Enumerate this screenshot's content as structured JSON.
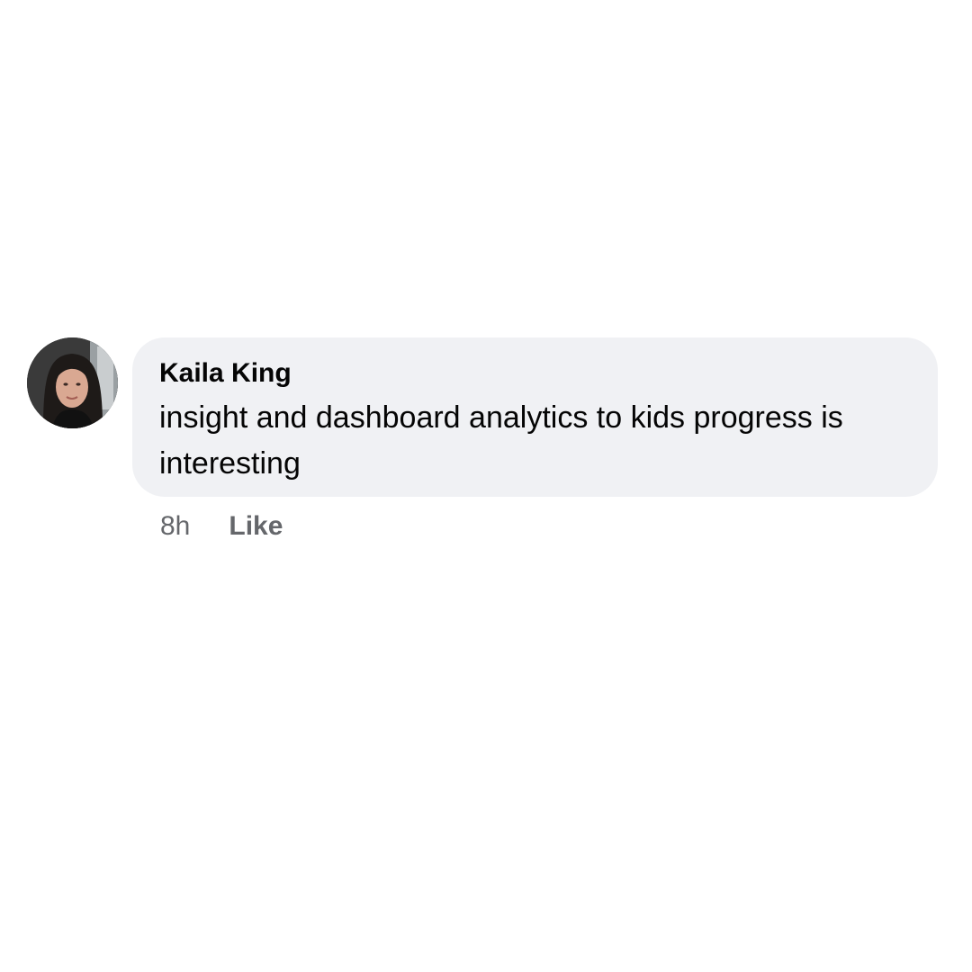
{
  "comment": {
    "author": "Kaila King",
    "text": "insight and dashboard analytics to kids progress is interesting",
    "timestamp": "8h",
    "like_label": "Like"
  },
  "colors": {
    "bubble_background": "#f0f1f4",
    "text_primary": "#050505",
    "text_secondary": "#65676b"
  },
  "icons": {
    "avatar": "profile-photo"
  }
}
